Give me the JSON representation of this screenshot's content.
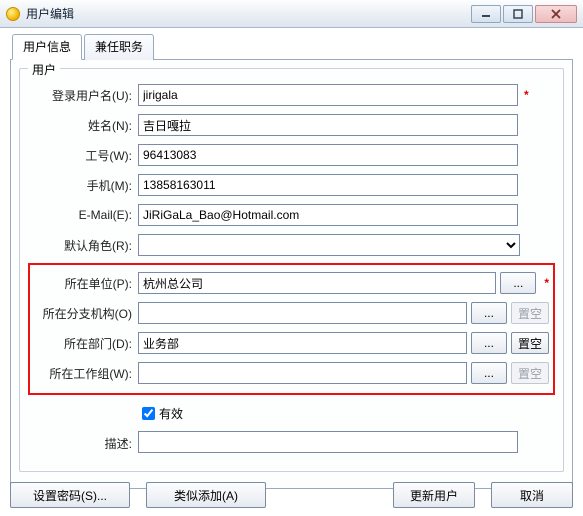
{
  "window": {
    "title": "用户编辑"
  },
  "tabs": {
    "user_info": "用户信息",
    "concurrent": "兼任职务"
  },
  "group": {
    "title": "用户"
  },
  "labels": {
    "login": "登录用户名(U):",
    "name": "姓名(N):",
    "empno": "工号(W):",
    "mobile": "手机(M):",
    "email": "E-Mail(E):",
    "default_role": "默认角色(R):",
    "unit": "所在单位(P):",
    "branch": "所在分支机构(O)",
    "dept": "所在部门(D):",
    "workgroup": "所在工作组(W):",
    "valid": "有效",
    "desc": "描述:"
  },
  "values": {
    "login": "jirigala",
    "name": "吉日嘎拉",
    "empno": "96413083",
    "mobile": "13858163011",
    "email": "JiRiGaLa_Bao@Hotmail.com",
    "default_role": "",
    "unit": "杭州总公司",
    "branch": "",
    "dept": "业务部",
    "workgroup": "",
    "valid_checked": true,
    "desc": ""
  },
  "buttons": {
    "browse": "...",
    "clear": "置空",
    "set_password": "设置密码(S)...",
    "similar_add": "类似添加(A)",
    "update_user": "更新用户",
    "cancel": "取消"
  },
  "required_marker": "*"
}
